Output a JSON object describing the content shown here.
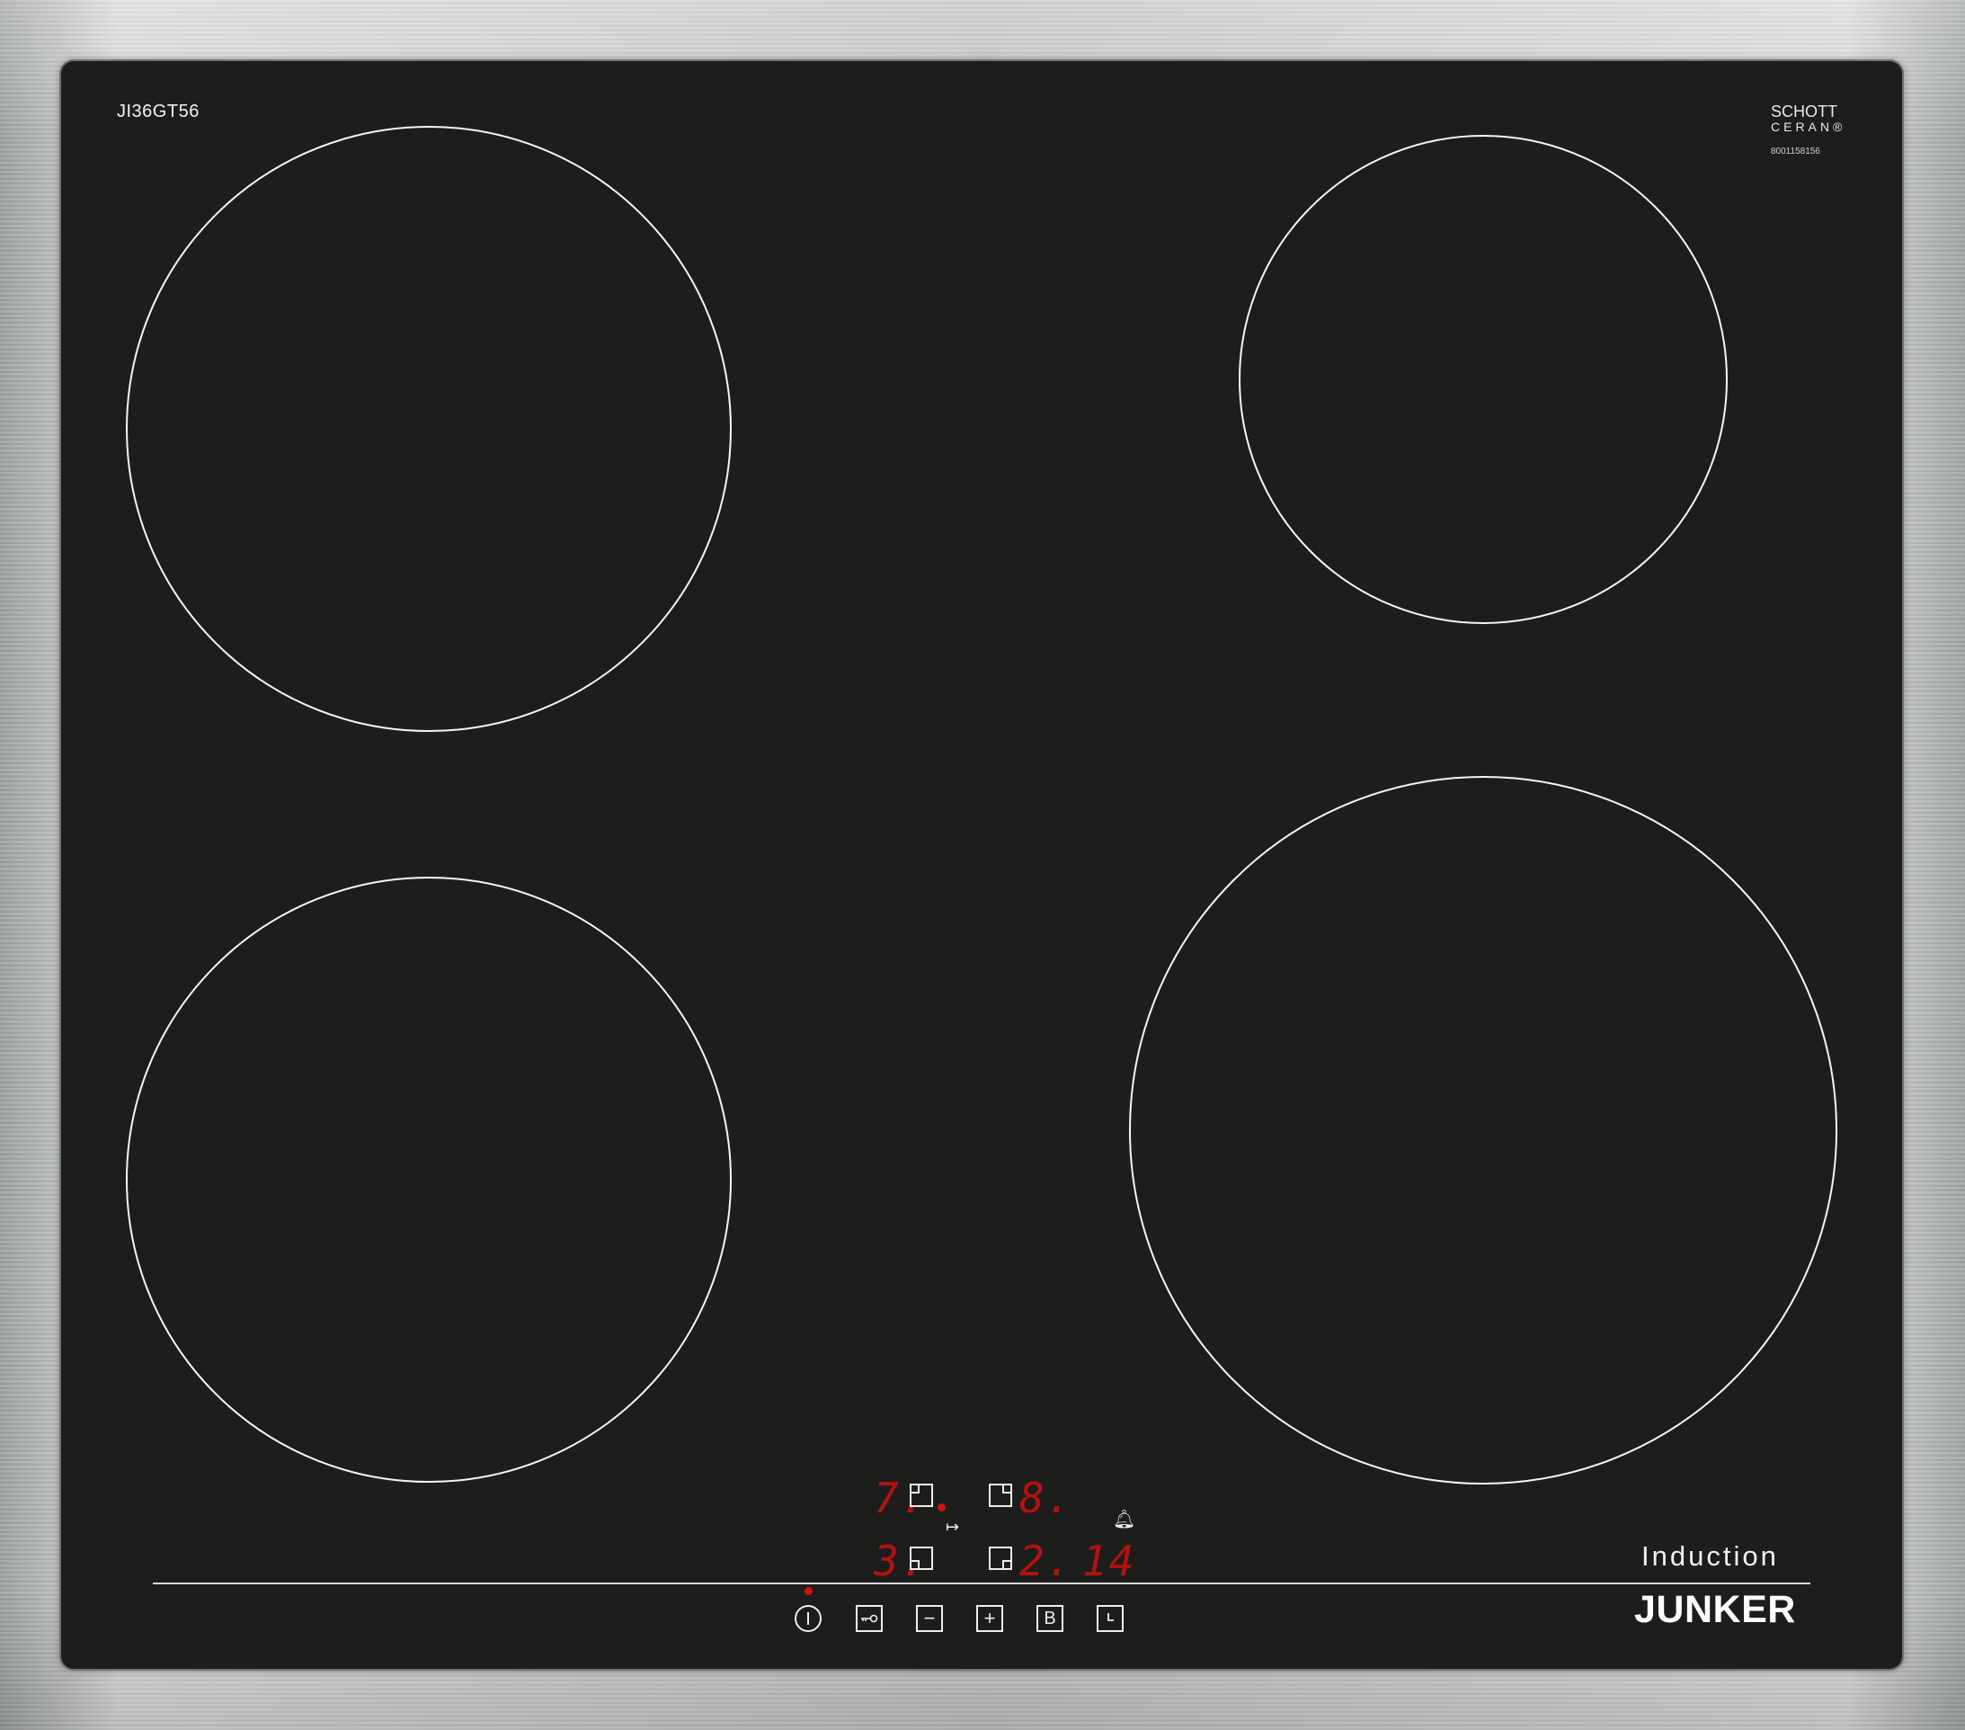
{
  "hob": {
    "model": "JI36GT56",
    "glass_brand_line1": "SCHOTT",
    "glass_brand_line2": "CERAN®",
    "glass_code": "8001158156",
    "subtitle": "Induction",
    "brand": "JUNKER"
  },
  "display": {
    "front_left_level": "7.",
    "back_right_level": "8.",
    "back_left_level": "3.",
    "front_right_level": "2.",
    "timer_value": "14"
  },
  "icons": {
    "power": "power-icon",
    "lock": "key-icon",
    "minus": "minus-icon",
    "plus": "plus-icon",
    "boost": "boost-icon",
    "timer": "clock-icon",
    "alarm": "bell-icon"
  },
  "controls": {
    "boost_label": "B",
    "minus_label": "−",
    "plus_label": "+"
  },
  "colors": {
    "glass": "#1d1e1c",
    "display_red": "#b3120f",
    "frame": "#c2c4c5"
  }
}
